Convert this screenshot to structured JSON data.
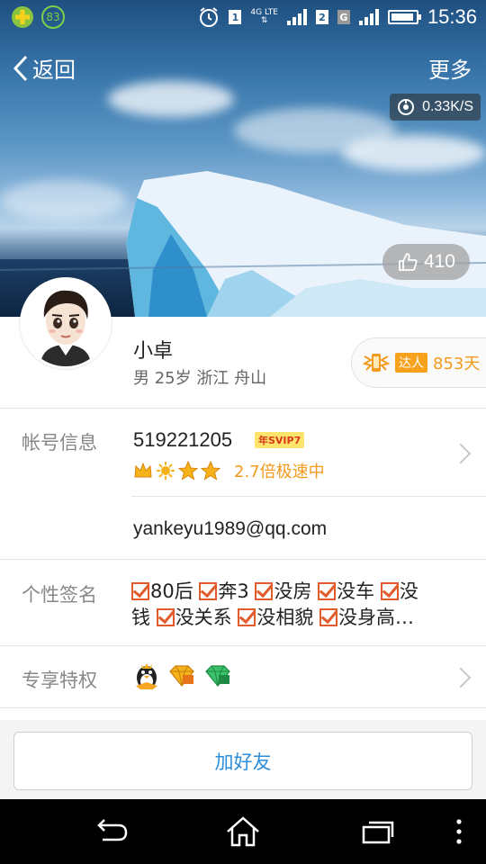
{
  "status_bar": {
    "left_badge": "83",
    "sim1": "1",
    "network_type": "4G LTE",
    "sim2": "2",
    "sim2_type": "G",
    "time": "15:36"
  },
  "header": {
    "back_label": "返回",
    "more_label": "更多",
    "net_speed": "0.33K/S",
    "like_count": "410"
  },
  "profile": {
    "name": "小卓",
    "info": "男 25岁 浙江 舟山",
    "expert_tag": "达人",
    "expert_days": "853天"
  },
  "account": {
    "label": "帐号信息",
    "qq_number": "519221205",
    "vip_badge": "年SVIP7",
    "speed_bonus": "2.7倍极速中",
    "email": "yankeyu1989@qq.com"
  },
  "signature": {
    "label": "个性签名",
    "line1_parts": [
      "80后",
      "奔3",
      "没房",
      "没车",
      "没"
    ],
    "line2_start": "钱",
    "line2_parts": [
      "没关系",
      "没相貌",
      "没身高…"
    ]
  },
  "privileges": {
    "label": "专享特权",
    "icons": [
      "qq-penguin-icon",
      "gold-diamond-icon",
      "green-diamond-icon"
    ]
  },
  "actions": {
    "add_friend": "加好友"
  },
  "colors": {
    "accent_orange": "#f39a1d",
    "button_blue": "#2b8ddc",
    "checkbox_red": "#e25b2c"
  }
}
